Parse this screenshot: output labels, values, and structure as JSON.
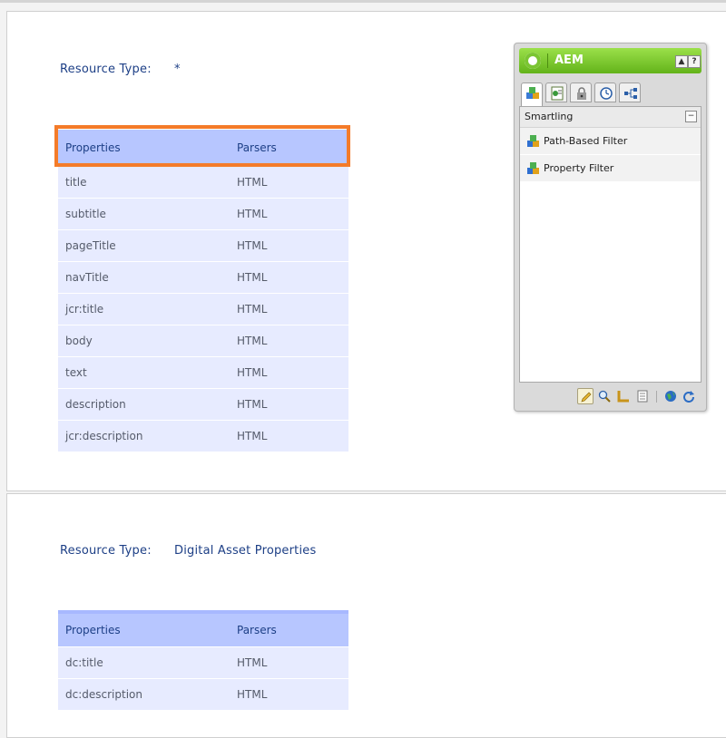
{
  "sections": [
    {
      "resource_type_label": "Resource Type:",
      "resource_type_value": "*",
      "header": {
        "properties": "Properties",
        "parsers": "Parsers"
      },
      "rows": [
        {
          "property": "title",
          "parser": "HTML"
        },
        {
          "property": "subtitle",
          "parser": "HTML"
        },
        {
          "property": "pageTitle",
          "parser": "HTML"
        },
        {
          "property": "navTitle",
          "parser": "HTML"
        },
        {
          "property": "jcr:title",
          "parser": "HTML"
        },
        {
          "property": "body",
          "parser": "HTML"
        },
        {
          "property": "text",
          "parser": "HTML"
        },
        {
          "property": "description",
          "parser": "HTML"
        },
        {
          "property": "jcr:description",
          "parser": "HTML"
        }
      ]
    },
    {
      "resource_type_label": "Resource Type:",
      "resource_type_value": "Digital Asset Properties",
      "header": {
        "properties": "Properties",
        "parsers": "Parsers"
      },
      "rows": [
        {
          "property": "dc:title",
          "parser": "HTML"
        },
        {
          "property": "dc:description",
          "parser": "HTML"
        }
      ]
    }
  ],
  "sidekick": {
    "title": "AEM",
    "up_button": "▲",
    "help_button": "?",
    "tabs": [
      "components-icon",
      "page-icon",
      "lock-icon",
      "versioning-icon",
      "workflow-icon"
    ],
    "group_label": "Smartling",
    "collapse": "−",
    "items": [
      {
        "label": "Path-Based Filter",
        "icon": "component-icon"
      },
      {
        "label": "Property Filter",
        "icon": "component-icon"
      }
    ],
    "tools": [
      "edit-pencil-icon",
      "preview-magnifier-icon",
      "design-ruler-icon",
      "properties-document-icon",
      "globe-icon",
      "refresh-icon"
    ]
  },
  "colors": {
    "header_bg": "#b7c6ff",
    "row_bg": "#e7ebff",
    "text_blue": "#1d3f86",
    "highlight": "#f47b29",
    "sidekick_green": "#7bc532"
  }
}
